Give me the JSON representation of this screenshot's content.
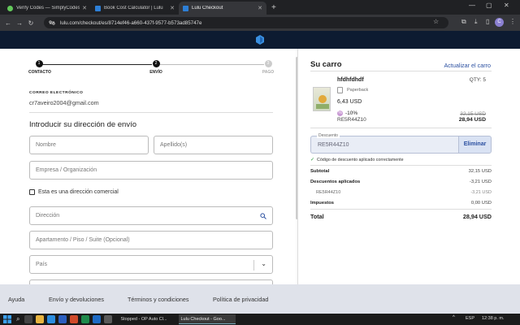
{
  "browser": {
    "tabs": [
      {
        "label": "Verify Codes — SimplyCodes",
        "fav": "#63c95b",
        "active": false
      },
      {
        "label": "Book Cost Calculator | Lulu",
        "fav": "#2d7fd6",
        "active": false
      },
      {
        "label": "Lulu Checkout",
        "fav": "#2d7fd6",
        "active": true
      }
    ],
    "url": "lulu.com/checkout/es/8714ef46-a660-437f-9577-b573ad85747e",
    "profile_initial": "C"
  },
  "steps": [
    {
      "num": "1",
      "label": "CONTACTO"
    },
    {
      "num": "2",
      "label": "ENVÍO"
    },
    {
      "num": "3",
      "label": "PAGO"
    }
  ],
  "contact": {
    "section_label": "CORREO ELECTRÓNICO",
    "email": "cr7aveiro2004@gmail.com"
  },
  "shipping": {
    "heading": "Introducir su dirección de envío",
    "name_placeholder": "Nombre",
    "lastname_placeholder": "Apellido(s)",
    "company_placeholder": "Empresa / Organización",
    "commercial_label": "Esta es una dirección comercial",
    "address_placeholder": "Dirección",
    "apartment_placeholder": "Apartamento / Piso / Suite (Opcional)",
    "country_placeholder": "País"
  },
  "cart": {
    "title": "Su carro",
    "update_link": "Actualizar el carro",
    "item": {
      "title": "hfdhfdhdf",
      "qty": "QTY: 5",
      "format": "Paperback",
      "unit_price": "6,43 USD",
      "discount_pct": "-10%",
      "code": "RE5R44Z10",
      "old_price": "32,15 USD",
      "new_price": "28,94 USD"
    },
    "discount": {
      "label": "Descuento",
      "value": "RE5R44Z10",
      "remove_label": "Eliminar",
      "success": "Código de descuento aplicado correctamente"
    },
    "summary": {
      "subtotal_label": "Subtotal",
      "subtotal": "32,15 USD",
      "discounts_label": "Descuentos aplicados",
      "discounts": "-3,21 USD",
      "code_label": "RE5R44Z10",
      "code_amount": "-3,21 USD",
      "taxes_label": "Impuestos",
      "taxes": "0,00 USD",
      "total_label": "Total",
      "total": "28,94 USD"
    }
  },
  "footer": {
    "links": [
      "Ayuda",
      "Envío y devoluciones",
      "Términos y condiciones",
      "Política de privacidad"
    ]
  },
  "taskbar": {
    "items": [
      "Stopped - OP Auto Cl...",
      "Lulu Checkout - Goo..."
    ],
    "lang": "ESP",
    "time": "12:38 p. m."
  }
}
